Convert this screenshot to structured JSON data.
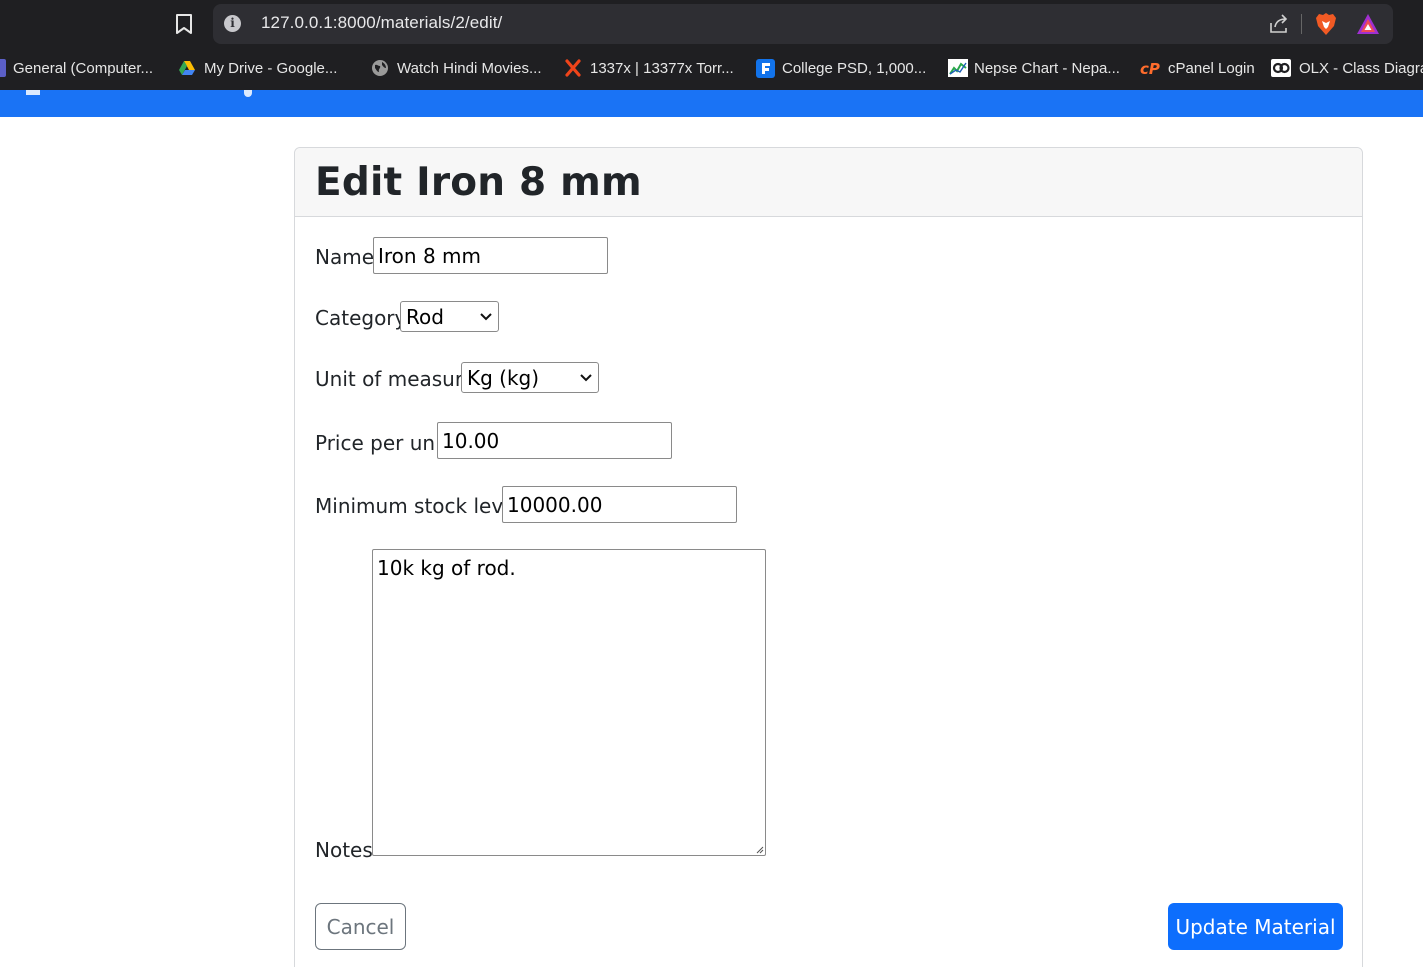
{
  "browser": {
    "url": "127.0.0.1:8000/materials/2/edit/",
    "bookmarks": [
      {
        "label": "General (Computer...",
        "icon": "teams-icon"
      },
      {
        "label": "My Drive - Google...",
        "icon": "google-drive-icon"
      },
      {
        "label": "Watch Hindi Movies...",
        "icon": "globe-icon"
      },
      {
        "label": "1337x | 13377x Torr...",
        "icon": "x-logo-icon"
      },
      {
        "label": "College PSD, 1,000...",
        "icon": "freepik-icon"
      },
      {
        "label": "Nepse Chart - Nepa...",
        "icon": "chart-icon"
      },
      {
        "label": "cPanel Login",
        "icon": "cpanel-icon"
      },
      {
        "label": "OLX - Class Diagra...",
        "icon": "olx-icon"
      }
    ]
  },
  "page": {
    "title": "Edit Iron 8 mm",
    "form": {
      "name_label": "Name",
      "name_value": "Iron 8 mm",
      "category_label": "Category",
      "category_value": "Rod",
      "unit_label": "Unit of measure",
      "unit_value": "Kg (kg)",
      "price_label": "Price per unit",
      "price_value": "10.00",
      "min_stock_label": "Minimum stock level",
      "min_stock_value": "10000.00",
      "notes_label": "Notes",
      "notes_value": "10k kg of rod."
    },
    "actions": {
      "cancel_label": "Cancel",
      "update_label": "Update Material"
    }
  },
  "colors": {
    "navbar": "#1a73f5",
    "primary_button": "#0d6efd",
    "secondary_outline": "#6c757d"
  }
}
